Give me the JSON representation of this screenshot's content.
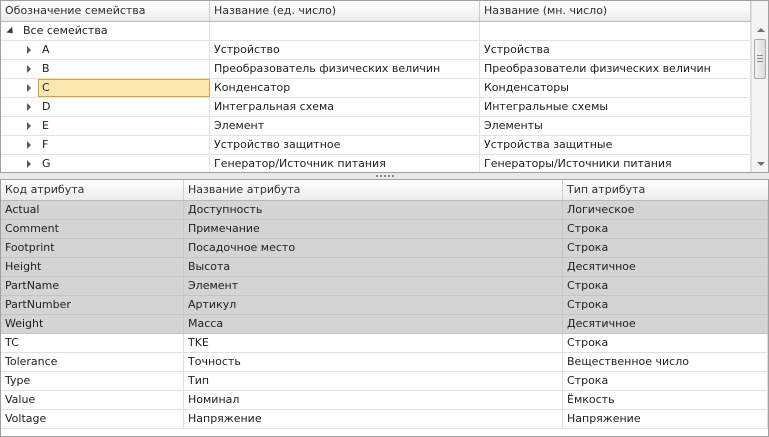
{
  "families": {
    "columns": [
      "Обозначение семейства",
      "Название (ед. число)",
      "Название (мн. число)"
    ],
    "root_label": "Все семейства",
    "rows": [
      {
        "code": "A",
        "singular": "Устройство",
        "plural": "Устройства"
      },
      {
        "code": "B",
        "singular": "Преобразователь физических величин",
        "plural": "Преобразователи физических величин"
      },
      {
        "code": "C",
        "singular": "Конденсатор",
        "plural": "Конденсаторы"
      },
      {
        "code": "D",
        "singular": "Интегральная схема",
        "plural": "Интегральные схемы"
      },
      {
        "code": "E",
        "singular": "Элемент",
        "plural": "Элементы"
      },
      {
        "code": "F",
        "singular": "Устройство защитное",
        "plural": "Устройства защитные"
      },
      {
        "code": "G",
        "singular": "Генератор/Источник питания",
        "plural": "Генераторы/Источники питания"
      }
    ],
    "selected_code": "C",
    "scrollbar": {
      "icons": [
        "scroll-up-icon",
        "scroll-down-icon"
      ]
    }
  },
  "attributes": {
    "columns": [
      "Код атрибута",
      "Название атрибута",
      "Тип атрибута"
    ],
    "rows": [
      {
        "code": "Actual",
        "name": "Доступность",
        "type": "Логическое",
        "inherited": true
      },
      {
        "code": "Comment",
        "name": "Примечание",
        "type": "Строка",
        "inherited": true
      },
      {
        "code": "Footprint",
        "name": "Посадочное место",
        "type": "Строка",
        "inherited": true
      },
      {
        "code": "Height",
        "name": "Высота",
        "type": "Десятичное",
        "inherited": true
      },
      {
        "code": "PartName",
        "name": "Элемент",
        "type": "Строка",
        "inherited": true
      },
      {
        "code": "PartNumber",
        "name": "Артикул",
        "type": "Строка",
        "inherited": true
      },
      {
        "code": "Weight",
        "name": "Масса",
        "type": "Десятичное",
        "inherited": true
      },
      {
        "code": "TC",
        "name": "TKE",
        "type": "Строка",
        "inherited": false
      },
      {
        "code": "Tolerance",
        "name": "Точность",
        "type": "Вещественное число",
        "inherited": false
      },
      {
        "code": "Type",
        "name": "Тип",
        "type": "Строка",
        "inherited": false
      },
      {
        "code": "Value",
        "name": "Номинал",
        "type": "Ёмкость",
        "inherited": false
      },
      {
        "code": "Voltage",
        "name": "Напряжение",
        "type": "Напряжение",
        "inherited": false
      }
    ]
  },
  "colors": {
    "selection_fill": "#fbe7b0",
    "selection_border": "#d8a52e",
    "inherited_row": "#d4d4d4"
  }
}
